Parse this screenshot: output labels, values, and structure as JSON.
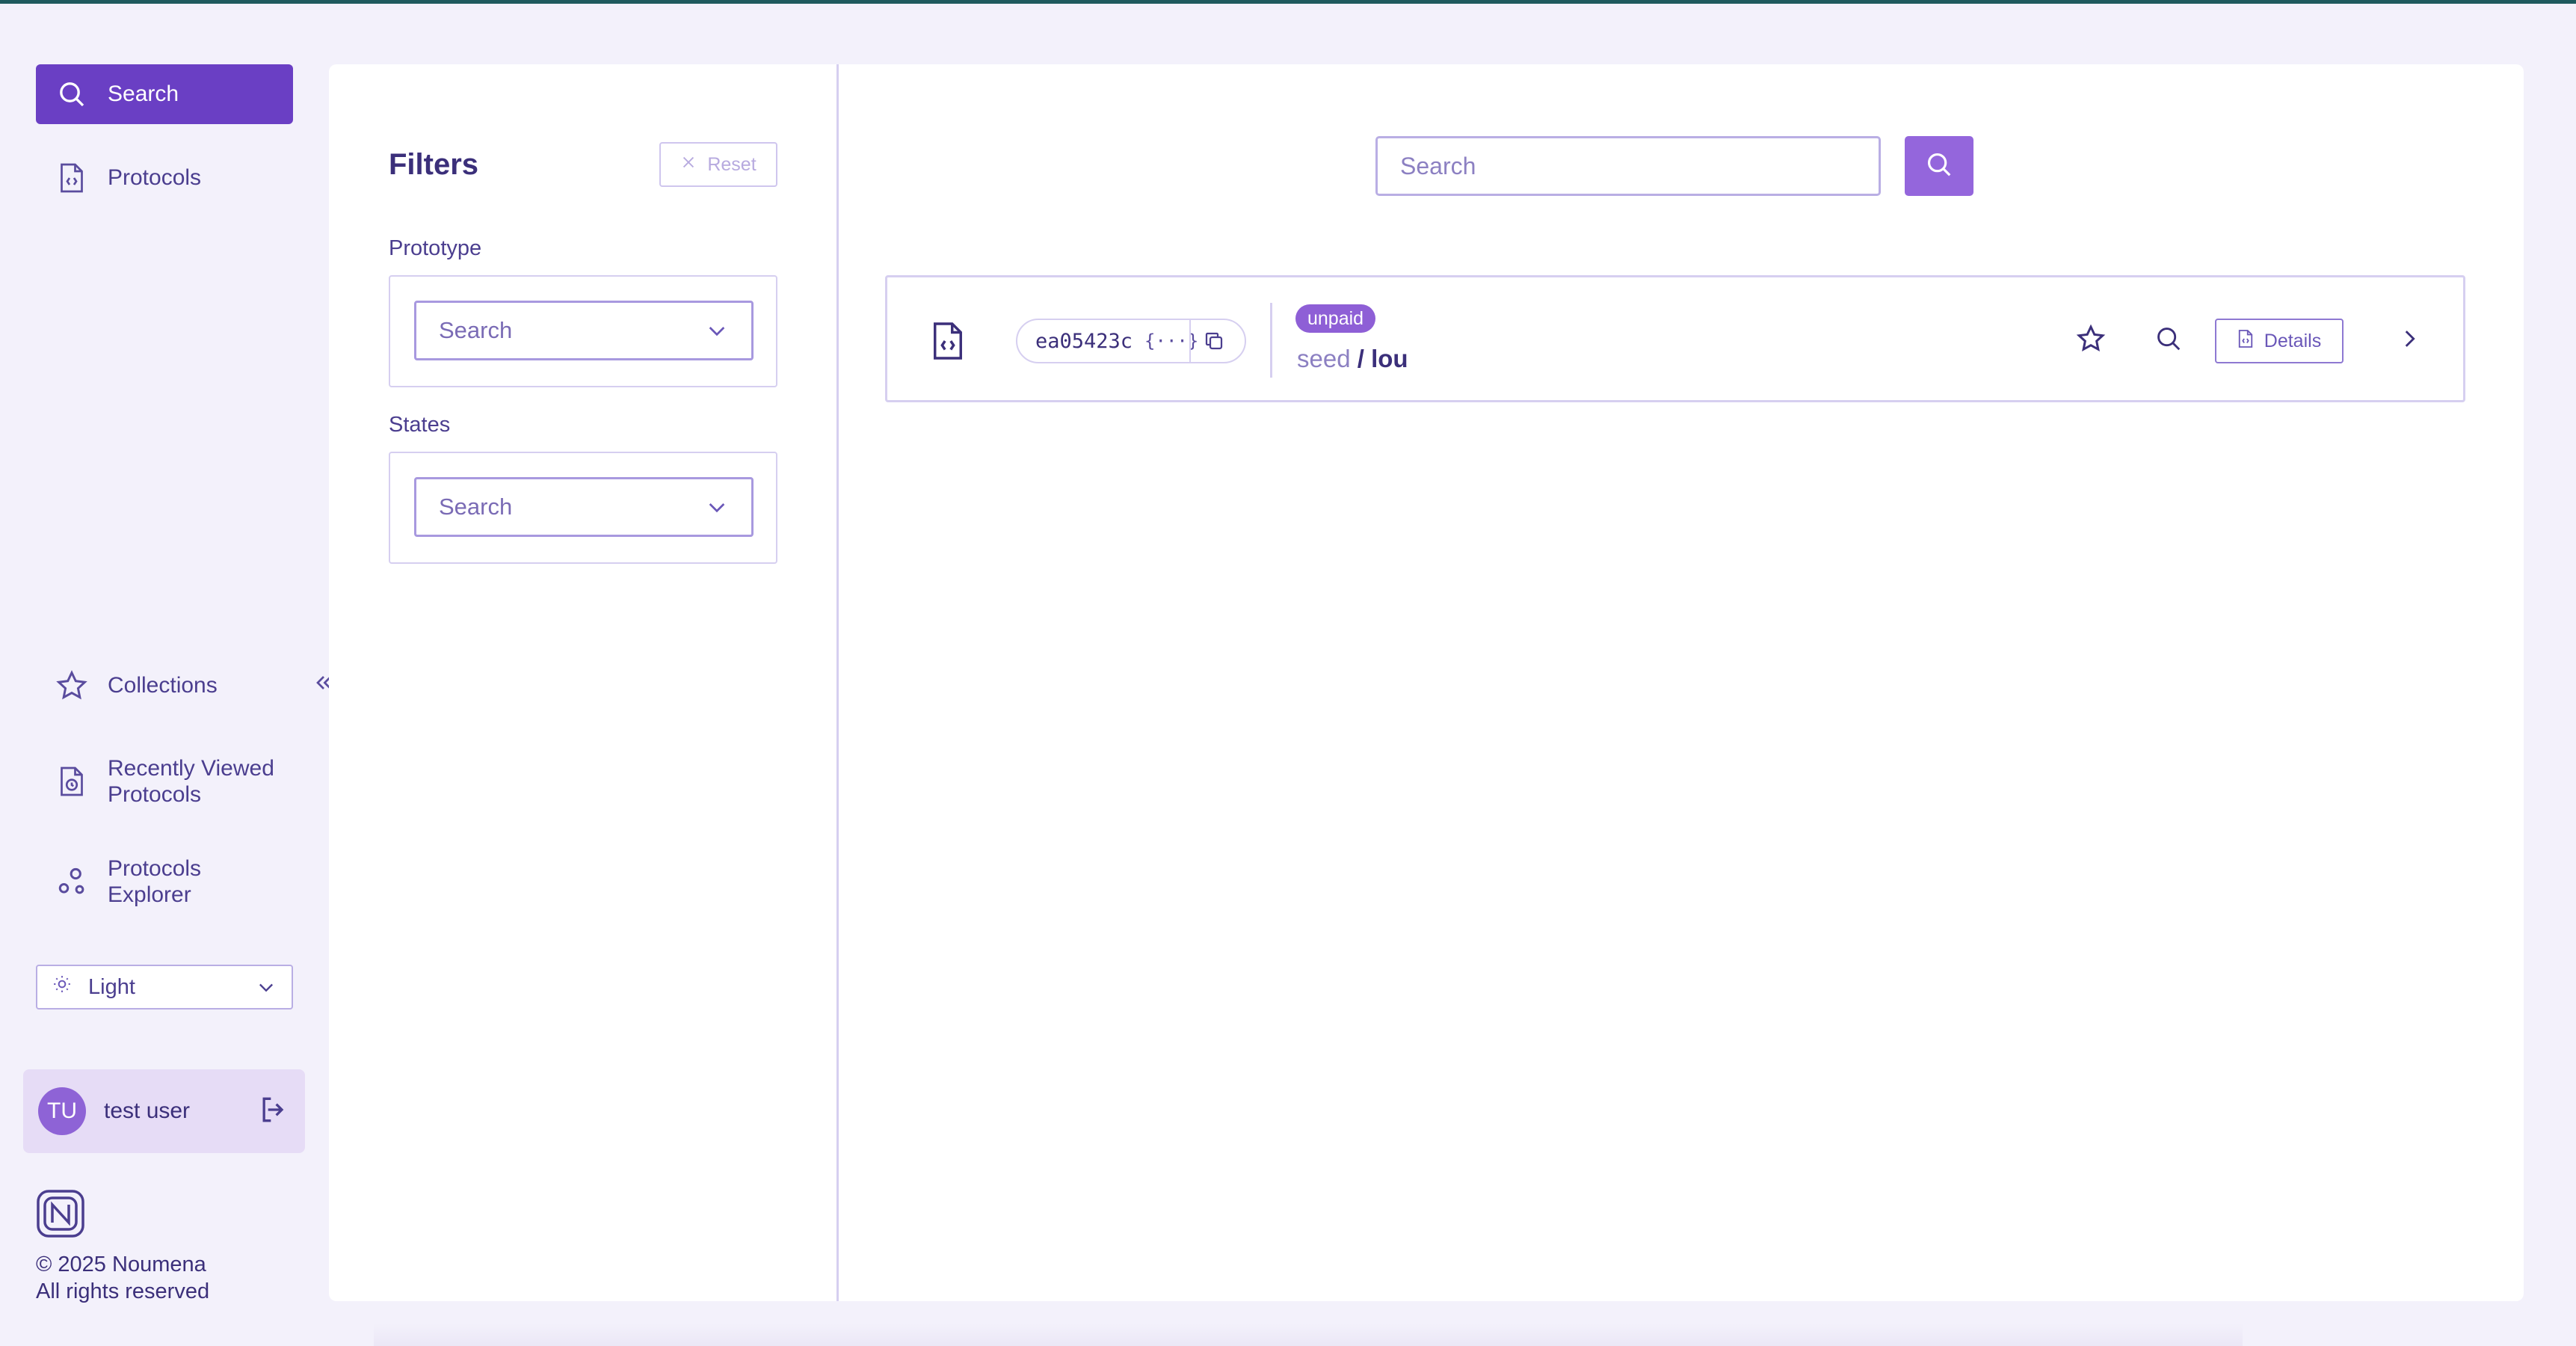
{
  "sidebar": {
    "nav_top": [
      {
        "label": "Search",
        "icon": "search-icon",
        "active": true
      },
      {
        "label": "Protocols",
        "icon": "file-code-icon",
        "active": false
      }
    ],
    "nav_bottom": [
      {
        "label": "Collections",
        "icon": "star-icon"
      },
      {
        "label_line1": "Recently Viewed",
        "label_line2": "Protocols",
        "icon": "file-clock-icon"
      },
      {
        "label_line1": "Protocols",
        "label_line2": "Explorer",
        "icon": "nodes-icon"
      }
    ],
    "theme": {
      "value": "Light",
      "icon": "sun-icon"
    },
    "user": {
      "initials": "TU",
      "name": "test user"
    },
    "copyright_line1": "© 2025 Noumena",
    "copyright_line2": "All rights reserved"
  },
  "filters": {
    "title": "Filters",
    "reset_label": "Reset",
    "prototype": {
      "label": "Prototype",
      "placeholder": "Search"
    },
    "states": {
      "label": "States",
      "placeholder": "Search"
    }
  },
  "search": {
    "placeholder": "Search"
  },
  "results": [
    {
      "id": "ea05423c",
      "id_suffix": "{···}",
      "status": "unpaid",
      "namespace": "seed",
      "separator": " / ",
      "name": "lou",
      "details_label": "Details"
    }
  ],
  "colors": {
    "accent": "#6a3fc4",
    "accent_light": "#9466dc",
    "badge": "#8e5fd6",
    "background": "#f3f1fb",
    "text": "#3b2f7a"
  }
}
